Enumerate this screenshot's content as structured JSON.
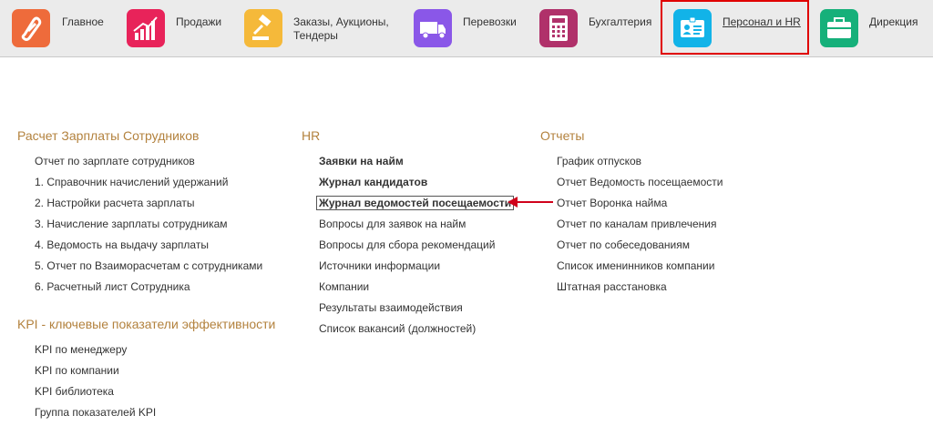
{
  "nav": {
    "items": [
      {
        "label": "Главное",
        "color": "#ee6b3b",
        "icon": "logo-icon"
      },
      {
        "label": "Продажи",
        "color": "#e8235a",
        "icon": "sales-chart-icon"
      },
      {
        "label": "Заказы, Аукционы, Тендеры",
        "color": "#f5b93a",
        "icon": "gavel-icon"
      },
      {
        "label": "Перевозки",
        "color": "#8a57e8",
        "icon": "truck-icon"
      },
      {
        "label": "Бухгалтерия",
        "color": "#b0316a",
        "icon": "calculator-icon"
      },
      {
        "label": "Персонал и HR",
        "color": "#12b3e8",
        "icon": "badge-icon",
        "active": true
      },
      {
        "label": "Дирекция",
        "color": "#16b07a",
        "icon": "briefcase-icon"
      }
    ],
    "highlight_color": "#e00000"
  },
  "sections": {
    "payroll": {
      "title": "Расчет Зарплаты Сотрудников",
      "items": [
        "Отчет по зарплате сотрудников",
        "1. Справочник начислений удержаний",
        "2. Настройки расчета зарплаты",
        "3. Начисление зарплаты сотрудникам",
        "4. Ведомость на выдачу зарплаты",
        "5. Отчет по Взаиморасчетам с сотрудниками",
        "6. Расчетный лист Сотрудника"
      ]
    },
    "kpi": {
      "title": "KPI - ключевые показатели эффективности",
      "items": [
        "KPI по менеджеру",
        "KPI по компании",
        "KPI библиотека",
        "Группа показателей KPI"
      ]
    },
    "hr": {
      "title": "HR",
      "items": [
        "Заявки на найм",
        "Журнал кандидатов",
        "Журнал ведомостей посещаемости",
        "Вопросы для заявок на найм",
        "Вопросы для сбора рекомендаций",
        "Источники информации",
        "Компании",
        "Результаты взаимодействия",
        "Список вакансий (должностей)"
      ]
    },
    "reports": {
      "title": "Отчеты",
      "items": [
        "График отпусков",
        "Отчет Ведомость посещаемости",
        "Отчет Воронка найма",
        "Отчет по каналам привлечения",
        "Отчет по собеседованиям",
        "Список именинников компании",
        "Штатная расстановка"
      ]
    }
  },
  "section_title_color": "#b3823e",
  "arrow_color": "#d0021b"
}
